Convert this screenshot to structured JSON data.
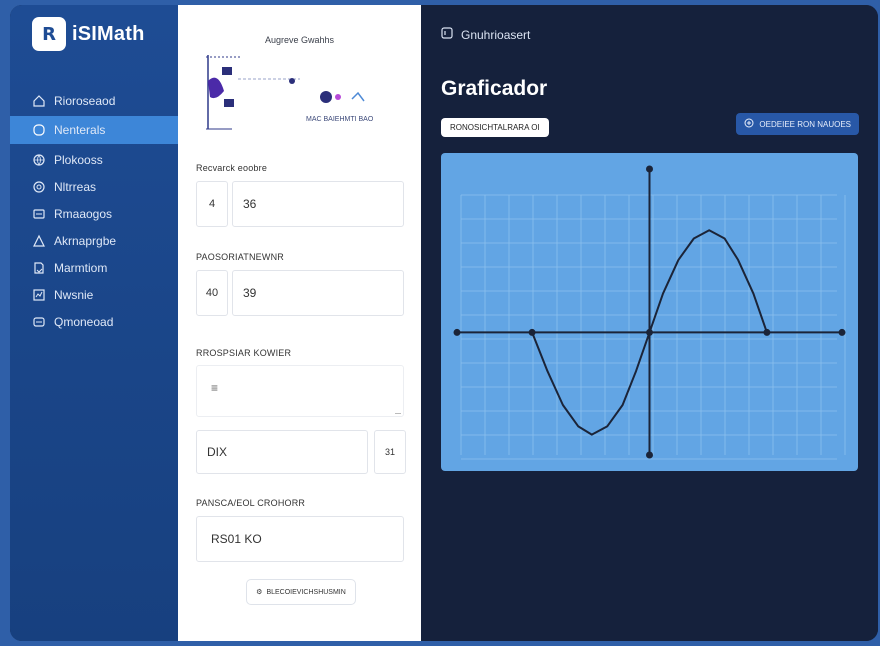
{
  "app": {
    "logo_text": "iSIMath",
    "logo_mark": "R"
  },
  "sidebar": {
    "items": [
      {
        "label": "Rioroseaod",
        "icon": "home-icon",
        "active": false
      },
      {
        "label": "Nenterals",
        "icon": "circle-icon",
        "active": true
      },
      {
        "label": "Plokooss",
        "icon": "globe-icon",
        "active": false
      },
      {
        "label": "Nltrreas",
        "icon": "target-icon",
        "active": false
      },
      {
        "label": "Rmaaogos",
        "icon": "folder-icon",
        "active": false
      },
      {
        "label": "Akrnaprgbe",
        "icon": "triangle-icon",
        "active": false
      },
      {
        "label": "Marmtiom",
        "icon": "document-icon",
        "active": false
      },
      {
        "label": "Nwsnie",
        "icon": "chart-icon",
        "active": false
      },
      {
        "label": "Qmoneoad",
        "icon": "box-icon",
        "active": false
      }
    ]
  },
  "panel": {
    "title": "Augreve Gwahhs",
    "field1": {
      "label": "Recvarck eoobre",
      "prefix": "4",
      "value": "36"
    },
    "field2": {
      "label": "PAOSORIATNEWNR",
      "prefix": "40",
      "value": "39"
    },
    "field3": {
      "label": "RROSPSIAR KOWIER",
      "icon": "list-icon"
    },
    "field4": {
      "value": "DIX",
      "suffix": "31"
    },
    "field5": {
      "label": "PANSCA/EOL CROHORR",
      "value": "RS01 KO"
    },
    "bottom_button": {
      "label": "BLECOIEVICHSHUSMIN",
      "icon": "settings-icon"
    },
    "diagram_text": "MAC  BAIEHMTI  BAO"
  },
  "main": {
    "topbar_label": "Gnuhrioasert",
    "title": "Graficador",
    "chip_label": "RONOSICHTALRARA OI",
    "action_button": {
      "label": "OEDEIEE RON NAUOES",
      "icon": "plus-circle-icon"
    }
  },
  "chart_data": {
    "type": "line",
    "title": "",
    "xlabel": "",
    "ylabel": "",
    "grid": true,
    "xlim": [
      -1,
      1
    ],
    "ylim": [
      -1.2,
      1.6
    ],
    "series": [
      {
        "x": [
          -0.61,
          -0.53,
          -0.45,
          -0.37,
          -0.3,
          -0.22,
          -0.14,
          -0.07,
          0,
          0.07,
          0.15,
          0.23,
          0.31,
          0.39,
          0.46,
          0.54,
          0.61
        ],
        "y": [
          0,
          -0.38,
          -0.71,
          -0.92,
          -1,
          -0.92,
          -0.71,
          -0.38,
          0,
          0.38,
          0.71,
          0.92,
          1,
          0.92,
          0.71,
          0.38,
          0
        ]
      }
    ],
    "points": [
      {
        "x": -1,
        "y": 0
      },
      {
        "x": -0.61,
        "y": 0
      },
      {
        "x": 0,
        "y": 0
      },
      {
        "x": 0.61,
        "y": 0
      },
      {
        "x": 1,
        "y": 0
      },
      {
        "x": 0,
        "y": 1.6
      },
      {
        "x": 0,
        "y": -1.2
      }
    ]
  }
}
